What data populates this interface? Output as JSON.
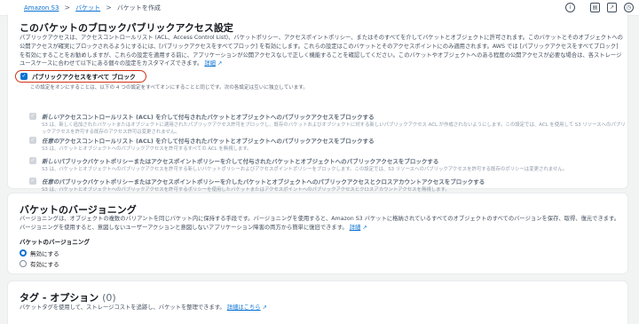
{
  "breadcrumb": {
    "items": [
      "Amazon S3",
      "バケット"
    ],
    "separator": ">",
    "current": "バケットを作成"
  },
  "top_icons": [
    "info-icon",
    "feedback-icon",
    "external-icon",
    "clock-icon"
  ],
  "block_public_access": {
    "title": "このバケットのブロックパブリックアクセス設定",
    "description": "パブリックアクセスは、アクセスコントロールリスト (ACL、Access Control List)、バケットポリシー、アクセスポイントポリシー、またはそのすべてを介してバケットとオブジェクトに許可されます。このバケットとそのオブジェクトへの公開アクセスが確実にブロックされるようにするには、[パブリックアクセスをすべてブロック] を有効にします。これらの設定はこのバケットとそのアクセスポイントにのみ適用されます。AWS では [パブリックアクセスをすべてブロック] を有効にすることをお勧めしますが、これらの設定を適用する前に、アプリケーションが公開アクセスなしで正しく機能することを確認してください。このバケットやオブジェクトへのある程度の公開アクセスが必要な場合は、各ストレージユースケースに合わせて以下にある個々の設定をカスタマイズできます。",
    "learn_more": "詳細",
    "block_all_label": "パブリックアクセスをすべて ブロック",
    "block_all_checked": true,
    "block_all_desc": "この設定をオンにすることは、以下の 4 つの設定をすべてオンにすることと同じです。次の各設定は互いに独立しています。",
    "sub_settings": [
      {
        "title_em": "新しい",
        "title": "アクセスコントロールリスト (ACL) を介して付与されたバケットとオブジェクトへのパブリックアクセスをブロックする",
        "desc": "S3 は、新しく追加されたバケットまたはオブジェクトに適用されたパブリックアクセス許可をブロックし、既存のバケットおよびオブジェクトに対する新しいパブリックアクセス ACL が作成されないようにします。この設定では、ACL を使用して S3 リソースへのパブリックアクセスを許可する既存のアクセス許可は変更されません。"
      },
      {
        "title_em": "任意の",
        "title": "アクセスコントロールリスト (ACL) を介して付与されたバケットとオブジェクトへのパブリックアクセスをブロックする",
        "desc": "S3 は、バケットとオブジェクトへのパブリックアクセスを許可するすべての ACL を無視します。"
      },
      {
        "title_em": "新しい",
        "title": "パブリックバケットポリシーまたはアクセスポイントポリシーを介して付与されたバケットとオブジェクトへのパブリックアクセスをブロックする",
        "desc": "S3 は、バケットとオブジェクトへのパブリックアクセスを許可する新しいバケットポリシーおよびアクセスポイントポリシーをブロックします。この設定では、S3 リソースへのパブリックアクセスを許可する既存のポリシーは変更されません。"
      },
      {
        "title_em": "任意の",
        "title": "パブリックバケットポリシーまたはアクセスポイントポリシーを介したバケットとオブジェクトへのパブリックアクセスとクロスアカウントアクセスをブロックする",
        "desc": "S3 は、バケットとオブジェクトへのパブリックアクセスを許可するポリシーを使用したバケットまたはアクセスポイントへのパブリックアクセスとクロスアカウントアクセスを無視します。"
      }
    ]
  },
  "versioning": {
    "title": "バケットのバージョニング",
    "description": "バージョニングは、オブジェクトの複数のバリアントを同じバケット内に保持する手段です。バージョニングを使用すると、Amazon S3 バケットに格納されているすべてのオブジェクトのすべてのバージョンを保存、取得、復元できます。バージョニングを使用すると、意図しないユーザーアクションと意図しないアプリケーション障害の両方から簡単に復旧できます。",
    "learn_more": "詳細",
    "label": "バケットのバージョニング",
    "options": [
      "無効にする",
      "有効にする"
    ],
    "selected": "無効にする"
  },
  "tags": {
    "title": "タグ - オプション",
    "count": "(0)",
    "description": "バケットタグを使用して、ストレージコストを追跡し、バケットを整理できます。",
    "learn_more": "詳細はこちら"
  },
  "colors": {
    "accent": "#0972d3",
    "highlight_border": "#d13212",
    "background": "#f2f3f3"
  }
}
